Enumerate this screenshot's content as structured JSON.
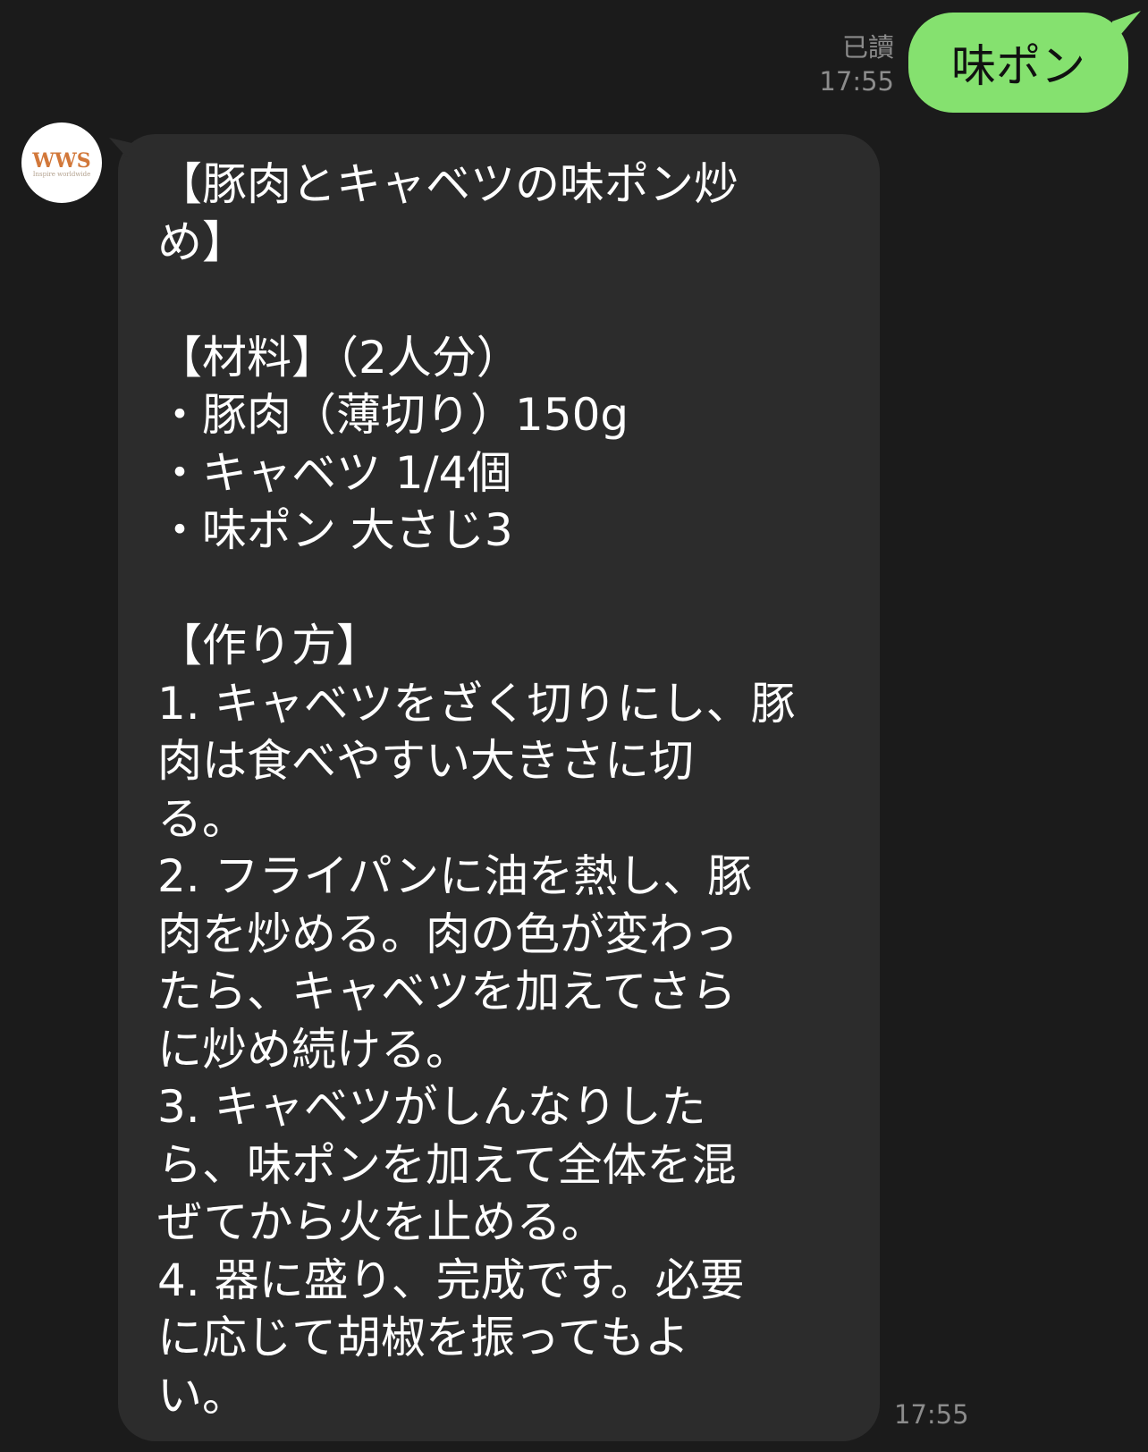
{
  "outgoing": {
    "read_status": "已讀",
    "time": "17:55",
    "text": "味ポン"
  },
  "incoming": {
    "avatar": {
      "logo_text": "WWS",
      "tagline": "Inspire worldwide",
      "brand_color": "#d2783a"
    },
    "lines": [
      "【豚肉とキャベツの味ポン炒",
      "め】",
      "",
      "【材料】（2人分）",
      "・豚肉（薄切り）150g",
      "・キャベツ 1/4個",
      "・味ポン 大さじ3",
      "",
      "【作り方】",
      "1. キャベツをざく切りにし、豚",
      "肉は食べやすい大きさに切",
      "る。",
      "2. フライパンに油を熱し、豚",
      "肉を炒める。肉の色が変わっ",
      "たら、キャベツを加えてさら",
      "に炒め続ける。",
      "3. キャベツがしんなりした",
      "ら、味ポンを加えて全体を混",
      "ぜてから火を止める。",
      "4. 器に盛り、完成です。必要",
      "に応じて胡椒を振ってもよ",
      "い。"
    ],
    "time": "17:55"
  },
  "colors": {
    "background": "#1b1b1b",
    "outgoing_bubble": "#85e16f",
    "incoming_bubble": "#2c2c2c",
    "meta_text": "#8c8c8c"
  }
}
